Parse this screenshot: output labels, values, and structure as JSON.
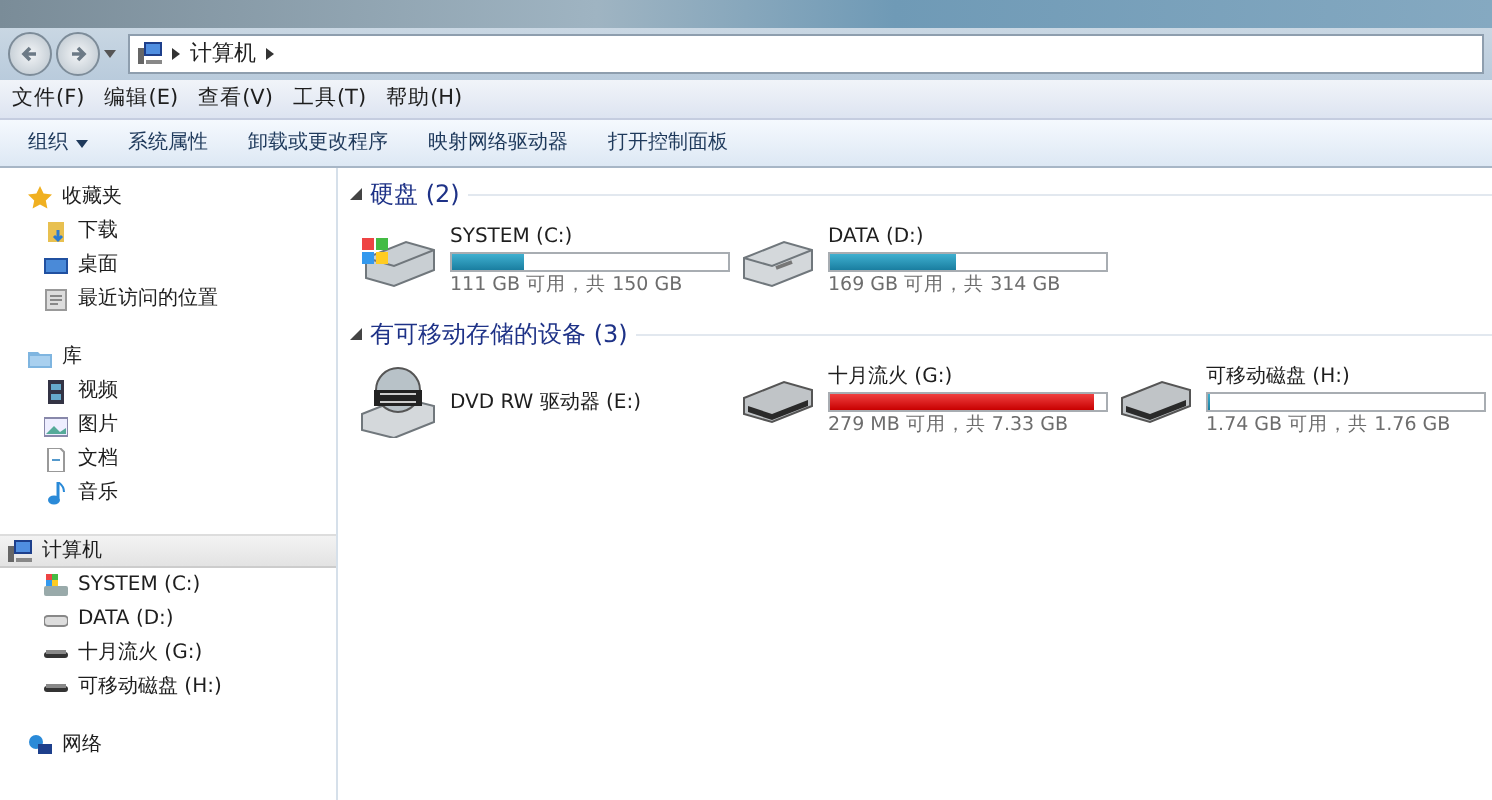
{
  "address": {
    "segments": [
      "计算机"
    ]
  },
  "menu": [
    "文件(F)",
    "编辑(E)",
    "查看(V)",
    "工具(T)",
    "帮助(H)"
  ],
  "toolbar": [
    {
      "label": "组织",
      "dropdown": true
    },
    {
      "label": "系统属性",
      "dropdown": false
    },
    {
      "label": "卸载或更改程序",
      "dropdown": false
    },
    {
      "label": "映射网络驱动器",
      "dropdown": false
    },
    {
      "label": "打开控制面板",
      "dropdown": false
    }
  ],
  "sidebar": [
    {
      "label": "收藏夹",
      "kind": "star",
      "selected": false,
      "children": [
        {
          "label": "下载",
          "kind": "download"
        },
        {
          "label": "桌面",
          "kind": "desktop"
        },
        {
          "label": "最近访问的位置",
          "kind": "recent"
        }
      ]
    },
    {
      "label": "库",
      "kind": "library",
      "selected": false,
      "children": [
        {
          "label": "视频",
          "kind": "video"
        },
        {
          "label": "图片",
          "kind": "picture"
        },
        {
          "label": "文档",
          "kind": "document"
        },
        {
          "label": "音乐",
          "kind": "music"
        }
      ]
    },
    {
      "label": "计算机",
      "kind": "computer",
      "selected": true,
      "children": [
        {
          "label": "SYSTEM (C:)",
          "kind": "sysdrive"
        },
        {
          "label": "DATA (D:)",
          "kind": "hdd"
        },
        {
          "label": "十月流火 (G:)",
          "kind": "usb"
        },
        {
          "label": "可移动磁盘 (H:)",
          "kind": "usb"
        }
      ]
    },
    {
      "label": "网络",
      "kind": "network",
      "selected": false
    }
  ],
  "groups": [
    {
      "title": "硬盘 (2)",
      "expanded": true,
      "drives": [
        {
          "name": "SYSTEM (C:)",
          "kind": "sysdrive",
          "level": 0.26,
          "space": "111 GB 可用，共 150 GB",
          "warning": false
        },
        {
          "name": "DATA (D:)",
          "kind": "hdd",
          "level": 0.46,
          "space": "169 GB 可用，共 314 GB",
          "warning": false
        }
      ]
    },
    {
      "title": "有可移动存储的设备 (3)",
      "expanded": true,
      "drives": [
        {
          "name": "DVD RW 驱动器 (E:)",
          "kind": "dvd"
        },
        {
          "name": "十月流火 (G:)",
          "kind": "usb",
          "level": 0.96,
          "space": "279 MB 可用，共 7.33 GB",
          "warning": true
        },
        {
          "name": "可移动磁盘 (H:)",
          "kind": "usb",
          "level": 0.01,
          "space": "1.74 GB 可用，共 1.76 GB",
          "warning": false
        }
      ]
    }
  ]
}
